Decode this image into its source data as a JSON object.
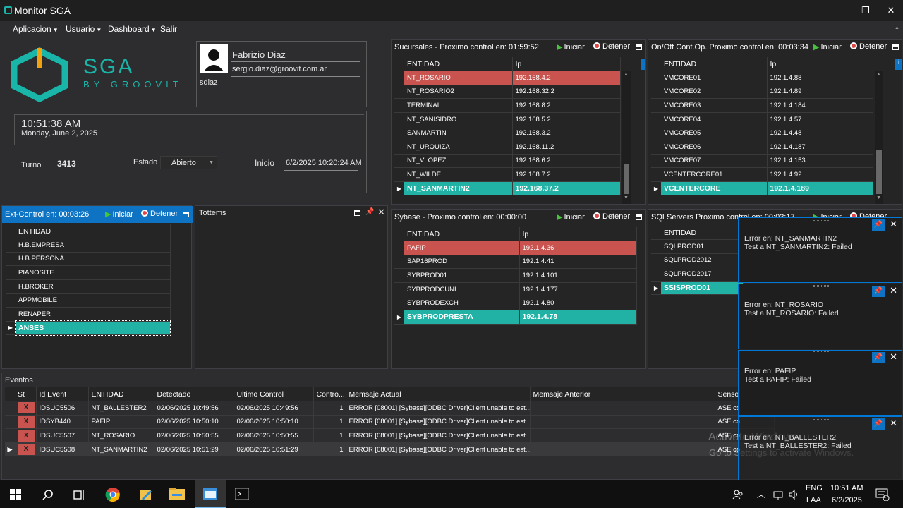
{
  "window": {
    "title": "Monitor SGA",
    "min": "—",
    "max": "❐",
    "close": "✕"
  },
  "menu": [
    {
      "label": "Aplicacion"
    },
    {
      "label": "Usuario"
    },
    {
      "label": "Dashboard"
    },
    {
      "label": "Salir"
    }
  ],
  "logo": {
    "name": "SGA",
    "tag": "BY GROOVIT",
    "brand_color": "#19b5a8"
  },
  "user": {
    "name": "Fabrizio Diaz",
    "email": "sergio.diaz@groovit.com.ar",
    "login": "sdiaz"
  },
  "clock": {
    "time": "10:51:38 AM",
    "date": "Monday, June 2, 2025"
  },
  "shift": {
    "turno_label": "Turno",
    "turno_value": "3413",
    "estado_label": "Estado",
    "estado_value": "Abierto",
    "inicio_label": "Inicio",
    "inicio_value": "6/2/2025 10:20:24 AM"
  },
  "actions": {
    "start": "Iniciar",
    "stop": "Detener"
  },
  "sucursales": {
    "title": "Sucursales - Proximo control en: 01:59:52",
    "col1": "ENTIDAD",
    "col2": "Ip",
    "rows": [
      {
        "e": "NT_ROSARIO",
        "ip": "192.168.4.2",
        "state": "red"
      },
      {
        "e": "NT_ROSARIO2",
        "ip": "192.168.32.2"
      },
      {
        "e": "TERMINAL",
        "ip": "192.168.8.2"
      },
      {
        "e": "NT_SANISIDRO",
        "ip": "192.168.5.2"
      },
      {
        "e": "SANMARTIN",
        "ip": "192.168.3.2"
      },
      {
        "e": "NT_URQUIZA",
        "ip": "192.168.11.2"
      },
      {
        "e": "NT_VLOPEZ",
        "ip": "192.168.6.2"
      },
      {
        "e": "NT_WILDE",
        "ip": "192.168.7.2"
      },
      {
        "e": "NT_SANMARTIN2",
        "ip": "192.168.37.2",
        "state": "sel"
      }
    ]
  },
  "onoff": {
    "title": "On/Off Cont.Op. Proximo control en: 00:03:34",
    "col1": "ENTIDAD",
    "col2": "Ip",
    "rows": [
      {
        "e": "VMCORE01",
        "ip": "192.1.4.88"
      },
      {
        "e": "VMCORE02",
        "ip": "192.1.4.89"
      },
      {
        "e": "VMCORE03",
        "ip": "192.1.4.184"
      },
      {
        "e": "VMCORE04",
        "ip": "192.1.4.57"
      },
      {
        "e": "VMCORE05",
        "ip": "192.1.4.48"
      },
      {
        "e": "VMCORE06",
        "ip": "192.1.4.187"
      },
      {
        "e": "VMCORE07",
        "ip": "192.1.4.153"
      },
      {
        "e": "VCENTERCORE01",
        "ip": "192.1.4.92"
      },
      {
        "e": "VCENTERCORE",
        "ip": "192.1.4.189",
        "state": "sel"
      }
    ]
  },
  "extcontrol": {
    "title": "Ext-Control en: 00:03:26",
    "col1": "ENTIDAD",
    "rows": [
      {
        "e": "H.B.EMPRESA"
      },
      {
        "e": "H.B.PERSONA"
      },
      {
        "e": "PIANOSITE"
      },
      {
        "e": "H.BROKER"
      },
      {
        "e": "APPMOBILE"
      },
      {
        "e": "RENAPER"
      },
      {
        "e": "ANSES",
        "state": "sel"
      }
    ]
  },
  "tottems": {
    "title": "Tottems"
  },
  "sybase": {
    "title": "Sybase - Proximo control en: 00:00:00",
    "col1": "ENTIDAD",
    "col2": "Ip",
    "rows": [
      {
        "e": "PAFIP",
        "ip": "192.1.4.36",
        "state": "red"
      },
      {
        "e": "SAP16PROD",
        "ip": "192.1.4.41"
      },
      {
        "e": "SYBPROD01",
        "ip": "192.1.4.101"
      },
      {
        "e": "SYBPRODCUNI",
        "ip": "192.1.4.177"
      },
      {
        "e": "SYBPRODEXCH",
        "ip": "192.1.4.80"
      },
      {
        "e": "SYBPRODPRESTA",
        "ip": "192.1.4.78",
        "state": "sel"
      }
    ]
  },
  "sqlservers": {
    "title": "SQLServers Proximo control en: 00:03:17",
    "col1": "ENTIDAD",
    "rows": [
      {
        "e": "SQLPROD01"
      },
      {
        "e": "SQLPROD2012"
      },
      {
        "e": "SQLPROD2017"
      },
      {
        "e": "SSISPROD01",
        "state": "sel"
      }
    ]
  },
  "eventos": {
    "title": "Eventos",
    "cols": [
      "St",
      "Id Event",
      "ENTIDAD",
      "Detectado",
      "Ultimo Control",
      "Contro...",
      "Memsaje Actual",
      "Memsaje Anterior",
      "Sensor"
    ],
    "rows": [
      {
        "st": "X",
        "id": "IDSUC5506",
        "e": "NT_BALLESTER2",
        "det": "02/06/2025 10:49:56",
        "ult": "02/06/2025 10:49:56",
        "c": "1",
        "msg": "ERROR [08001] [Sybase][ODBC Driver]Client unable to est...",
        "prev": "",
        "sensor": "ASE co"
      },
      {
        "st": "X",
        "id": "IDSYB440",
        "e": "PAFIP",
        "det": "02/06/2025 10:50:10",
        "ult": "02/06/2025 10:50:10",
        "c": "1",
        "msg": "ERROR [08001] [Sybase][ODBC Driver]Client unable to est...",
        "prev": "",
        "sensor": "ASE co"
      },
      {
        "st": "X",
        "id": "IDSUC5507",
        "e": "NT_ROSARIO",
        "det": "02/06/2025 10:50:55",
        "ult": "02/06/2025 10:50:55",
        "c": "1",
        "msg": "ERROR [08001] [Sybase][ODBC Driver]Client unable to est...",
        "prev": "",
        "sensor": "ASE co"
      },
      {
        "st": "X",
        "id": "IDSUC5508",
        "e": "NT_SANMARTIN2",
        "det": "02/06/2025 10:51:29",
        "ult": "02/06/2025 10:51:29",
        "c": "1",
        "msg": "ERROR [08001] [Sybase][ODBC Driver]Client unable to est...",
        "prev": "",
        "sensor": "ASE co"
      }
    ]
  },
  "notifications": [
    {
      "l1": "Error en: NT_SANMARTIN2",
      "l2": "Test a NT_SANMARTIN2: Failed"
    },
    {
      "l1": "Error en: NT_ROSARIO",
      "l2": "Test a NT_ROSARIO: Failed"
    },
    {
      "l1": "Error en: PAFIP",
      "l2": "Test a PAFIP: Failed"
    },
    {
      "l1": "Error en: NT_BALLESTER2",
      "l2": "Test a NT_BALLESTER2: Failed"
    }
  ],
  "watermark": {
    "line1": "Activate Windows",
    "line2": "Go to Settings to activate Windows."
  },
  "taskbar": {
    "lang1": "ENG",
    "lang2": "LAA",
    "time": "10:51 AM",
    "date": "6/2/2025",
    "notif_count": "1"
  }
}
